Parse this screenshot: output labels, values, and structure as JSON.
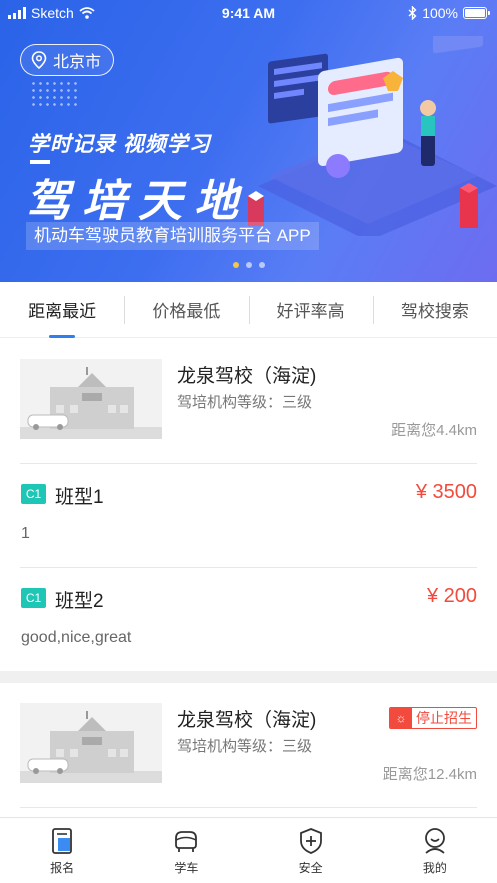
{
  "status_bar": {
    "carrier": "Sketch",
    "time": "9:41 AM",
    "battery": "100%"
  },
  "banner": {
    "city": "北京市",
    "slogan": "学时记录  视频学习",
    "title": "驾培天地",
    "subtitle": "机动车驾驶员教育培训服务平台 APP",
    "active_page": 0,
    "page_count": 3
  },
  "tabs": [
    {
      "label": "距离最近",
      "active": true
    },
    {
      "label": "价格最低",
      "active": false
    },
    {
      "label": "好评率高",
      "active": false
    },
    {
      "label": "驾校搜索",
      "active": false
    }
  ],
  "schools": [
    {
      "name": "龙泉驾校（海淀)",
      "level": "驾培机构等级：三级",
      "distance": "距离您4.4km",
      "classes": [
        {
          "tag": "C1",
          "name": "班型1",
          "price": "¥ 3500",
          "desc": "1"
        },
        {
          "tag": "C1",
          "name": "班型2",
          "price": "¥ 200",
          "desc": "good,nice,great"
        }
      ]
    },
    {
      "name": "龙泉驾校（海淀)",
      "level": "驾培机构等级：三级",
      "distance": "距离您12.4km",
      "status_badge": "停止招生",
      "classes": []
    }
  ],
  "bottom_nav": [
    {
      "label": "报名",
      "icon": "signup-icon"
    },
    {
      "label": "学车",
      "icon": "car-icon"
    },
    {
      "label": "安全",
      "icon": "shield-icon"
    },
    {
      "label": "我的",
      "icon": "profile-icon"
    }
  ],
  "colors": {
    "accent": "#2f7ff0",
    "price": "#f24a3c",
    "tag": "#1ec6b6",
    "banner": "#3d6ef0"
  }
}
